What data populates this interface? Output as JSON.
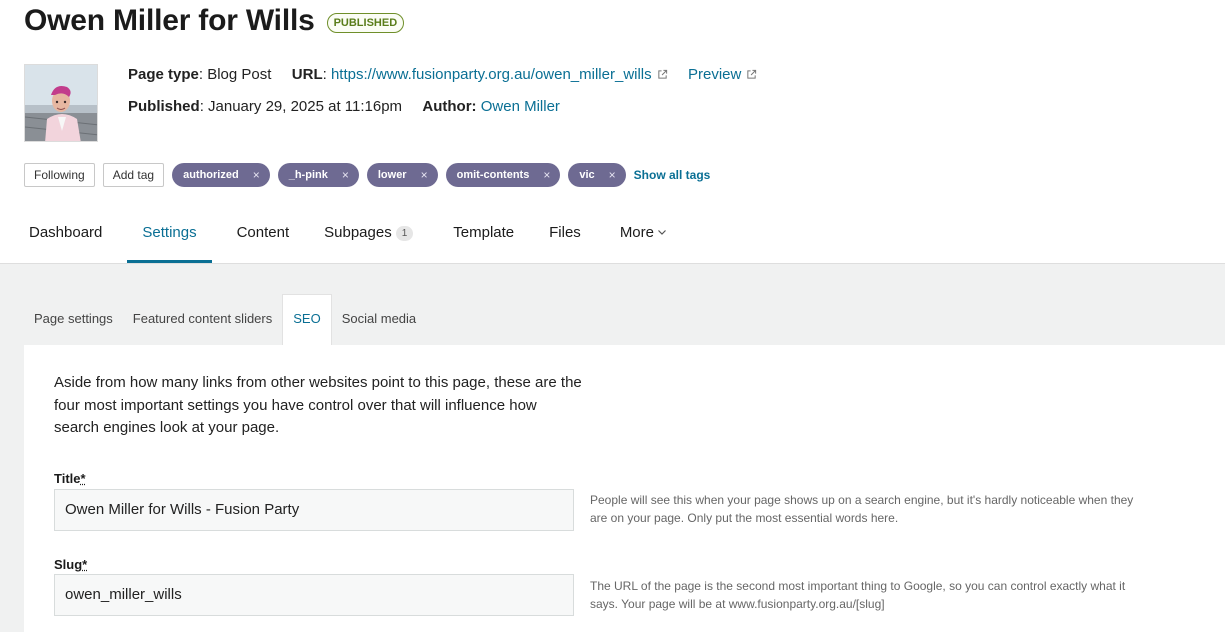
{
  "header": {
    "title": "Owen Miller for Wills",
    "status": "PUBLISHED"
  },
  "meta": {
    "page_type_label": "Page type",
    "page_type_value": "Blog Post",
    "url_label": "URL",
    "url_value": "https://www.fusionparty.org.au/owen_miller_wills",
    "preview_label": "Preview",
    "published_label": "Published",
    "published_value": "January 29, 2025 at 11:16pm",
    "author_label": "Author:",
    "author_value": "Owen Miller"
  },
  "tags_bar": {
    "following_label": "Following",
    "add_tag_label": "Add tag",
    "tags": [
      "authorized",
      "_h-pink",
      "lower",
      "omit-contents",
      "vic"
    ],
    "remove_glyph": "×",
    "show_all_label": "Show all tags"
  },
  "main_tabs": {
    "dashboard": "Dashboard",
    "settings": "Settings",
    "content": "Content",
    "subpages": "Subpages",
    "subpages_count": "1",
    "template": "Template",
    "files": "Files",
    "more": "More",
    "active": "Settings"
  },
  "sub_tabs": {
    "page_settings": "Page settings",
    "featured_sliders": "Featured content sliders",
    "seo": "SEO",
    "social_media": "Social media",
    "active": "SEO"
  },
  "seo": {
    "intro": "Aside from how many links from other websites point to this page, these are the four most important settings you have control over that will influence how search engines look at your page.",
    "title_label": "Title",
    "title_required": "*",
    "title_value": "Owen Miller for Wills - Fusion Party",
    "title_help": "People will see this when your page shows up on a search engine, but it's hardly noticeable when they are on your page. Only put the most essential words here.",
    "slug_label": "Slug",
    "slug_required": "*",
    "slug_value": "owen_miller_wills",
    "slug_help": "The URL of the page is the second most important thing to Google, so you can control exactly what it says. Your page will be at www.fusionparty.org.au/[slug]"
  },
  "colors": {
    "accent": "#0a6f94",
    "tag_bg": "#6e6a92",
    "published": "#5a7d1a",
    "content_bg": "#f0f1f1"
  },
  "icons": {
    "external_link": "external-link-icon",
    "remove_tag": "close-icon",
    "more_dropdown": "chevron-down-icon"
  }
}
